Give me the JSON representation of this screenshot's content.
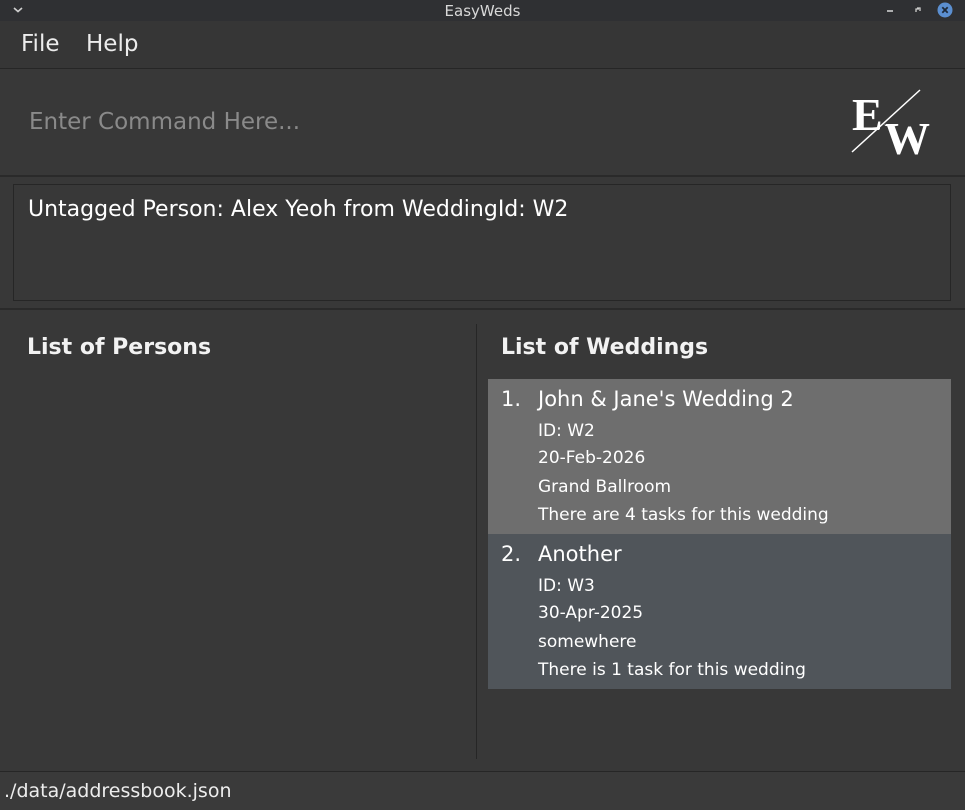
{
  "window": {
    "title": "EasyWeds",
    "controls": [
      "chevron-down-icon",
      "minimize-icon",
      "restore-icon",
      "close-icon"
    ]
  },
  "menu": {
    "file": "File",
    "help": "Help"
  },
  "command": {
    "placeholder": "Enter Command Here...",
    "value": ""
  },
  "logo": {
    "text": "EW"
  },
  "result": {
    "message": "Untagged Person: Alex Yeoh from WeddingId: W2"
  },
  "persons": {
    "title": "List of Persons",
    "items": []
  },
  "weddings": {
    "title": "List of Weddings",
    "items": [
      {
        "index": "1.",
        "name": "John & Jane's Wedding 2",
        "id": "ID: W2",
        "date": "20-Feb-2026",
        "venue": "Grand Ballroom",
        "tasks": "There are 4 tasks for this wedding",
        "selected": true
      },
      {
        "index": "2.",
        "name": "Another",
        "id": "ID: W3",
        "date": "30-Apr-2025",
        "venue": "somewhere",
        "tasks": "There is 1 task for this wedding",
        "selected": false
      }
    ]
  },
  "status": {
    "file_path": "./data/addressbook.json"
  },
  "colors": {
    "background": "#383838",
    "selected_card": "#6e6e6e",
    "card": "#50555a",
    "close_button": "#5b8fd1"
  }
}
